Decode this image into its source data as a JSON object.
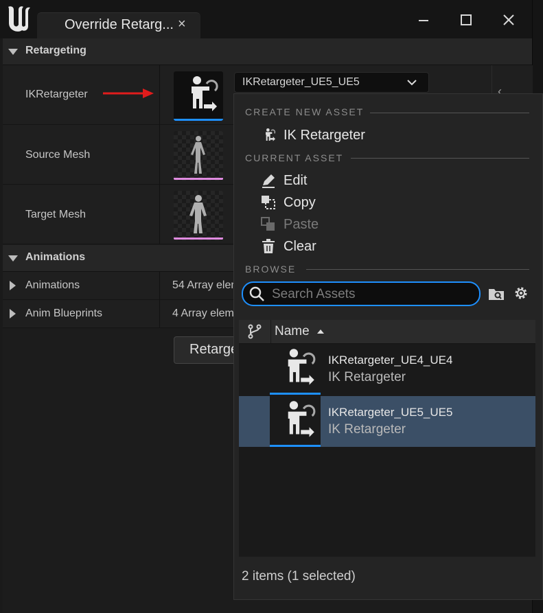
{
  "window": {
    "tab_title": "Override Retarg...",
    "tab_close": "×"
  },
  "details": {
    "categories": [
      {
        "label": "Retargeting"
      },
      {
        "label": "Animations"
      }
    ],
    "properties": {
      "ik_retargeter": {
        "name": "IKRetargeter",
        "value": "IKRetargeter_UE5_UE5"
      },
      "source_mesh": {
        "name": "Source Mesh"
      },
      "target_mesh": {
        "name": "Target Mesh"
      },
      "animations": {
        "name": "Animations",
        "value": "54 Array elem"
      },
      "anim_blueprints": {
        "name": "Anim Blueprints",
        "value": "4 Array elem"
      }
    },
    "retarget_button": "Retarge"
  },
  "popup": {
    "create_new_asset": {
      "title": "CREATE NEW ASSET",
      "items": [
        {
          "label": "IK Retargeter",
          "icon": "retargeter-icon"
        }
      ]
    },
    "current_asset": {
      "title": "CURRENT ASSET",
      "items": [
        {
          "label": "Edit",
          "icon": "pencil-icon",
          "enabled": true
        },
        {
          "label": "Copy",
          "icon": "copy-icon",
          "enabled": true
        },
        {
          "label": "Paste",
          "icon": "paste-icon",
          "enabled": false
        },
        {
          "label": "Clear",
          "icon": "trash-icon",
          "enabled": true
        }
      ]
    },
    "browse": {
      "title": "BROWSE",
      "search_placeholder": "Search Assets"
    },
    "list": {
      "column_name": "Name",
      "rows": [
        {
          "name": "IKRetargeter_UE4_UE4",
          "type": "IK Retargeter",
          "selected": false
        },
        {
          "name": "IKRetargeter_UE5_UE5",
          "type": "IK Retargeter",
          "selected": true
        }
      ]
    },
    "status": "2 items (1 selected)"
  },
  "colors": {
    "accent_blue": "#1e90ff",
    "selection": "#3b4f66",
    "mesh_underline": "#e08be0",
    "arrow_red": "#e01c1c"
  }
}
